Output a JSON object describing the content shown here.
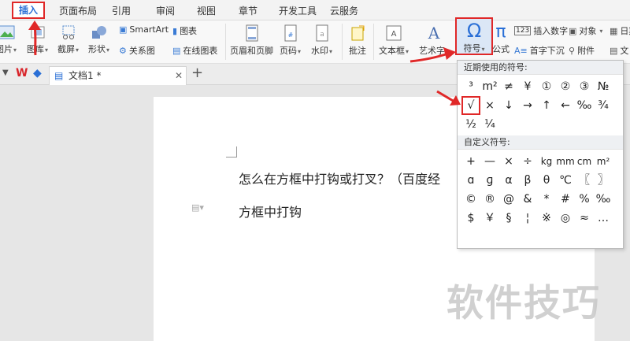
{
  "menu": {
    "tabs": [
      "插入",
      "页面布局",
      "引用",
      "审阅",
      "视图",
      "章节",
      "开发工具",
      "云服务"
    ]
  },
  "ribbon": {
    "picture": "图片",
    "gallery": "图库",
    "screenshot": "截屏",
    "shapes": "形状",
    "smartart": "SmartArt",
    "relation": "关系图",
    "chart": "图表",
    "online_chart": "在线图表",
    "header_footer": "页眉和页脚",
    "page_number": "页码",
    "watermark": "水印",
    "comment": "批注",
    "textbox": "文本框",
    "art": "艺术字",
    "symbol": "符号",
    "formula": "公式",
    "insert_number": "插入数字",
    "object": "对象",
    "date": "日期",
    "dropcap": "首字下沉",
    "attachment": "附件",
    "text_more": "文"
  },
  "tabbar": {
    "doc_tab": "文档1 *"
  },
  "document": {
    "line1": "怎么在方框中打钩或打叉？（百度经",
    "line2": "方框中打钩"
  },
  "symbols": {
    "recent_label": "近期使用的符号:",
    "recent": [
      "³",
      "m²",
      "≠",
      "¥",
      "①",
      "②",
      "③",
      "№",
      "√",
      "×",
      "↓",
      "→",
      "↑",
      "←",
      "‰",
      "¾",
      "½",
      "¼"
    ],
    "custom_label": "自定义符号:",
    "custom": [
      "+",
      "—",
      "×",
      "÷",
      "kg",
      "mm",
      "cm",
      "m²",
      "ɑ",
      "ɡ",
      "α",
      "β",
      "θ",
      "℃",
      "〖",
      "〗",
      "©",
      "®",
      "@",
      "&",
      "*",
      "#",
      "%",
      "‰",
      "$",
      "￥",
      "§",
      "¦",
      "※",
      "◎",
      "≈",
      "…"
    ]
  },
  "watermark": "软件技巧",
  "colors": {
    "highlight": "#e02828",
    "accent": "#2a6fd6"
  }
}
